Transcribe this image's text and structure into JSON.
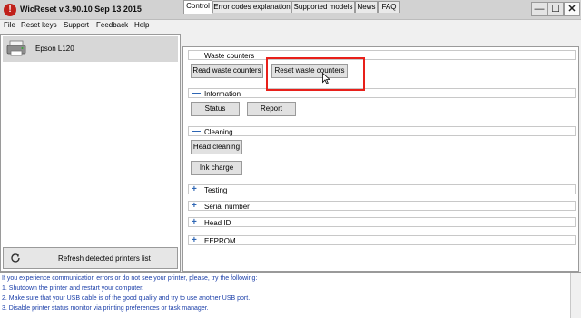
{
  "window": {
    "title": "WicReset v.3.90.10 Sep 13 2015",
    "app_icon": "!",
    "minimize": "—",
    "maximize": "☐",
    "close": "✕"
  },
  "menu": [
    "File",
    "Reset keys",
    "Support",
    "Feedback",
    "Help"
  ],
  "printers": [
    {
      "name": "Epson L120",
      "icon": "printer-icon"
    }
  ],
  "refresh_button": "Refresh detected printers list",
  "tabs": [
    "Control",
    "Error codes explanation",
    "Supported models",
    "News",
    "FAQ"
  ],
  "active_tab": "Control",
  "groups": {
    "waste": {
      "label": "Waste counters",
      "expanded": true,
      "buttons": [
        "Read waste counters",
        "Reset waste counters"
      ]
    },
    "information": {
      "label": "Information",
      "expanded": true,
      "buttons": [
        "Status",
        "Report"
      ]
    },
    "cleaning": {
      "label": "Cleaning",
      "expanded": true,
      "buttons": [
        "Head cleaning",
        "Ink charge"
      ]
    },
    "testing": {
      "label": "Testing",
      "expanded": false
    },
    "serial": {
      "label": "Serial number",
      "expanded": false
    },
    "headid": {
      "label": "Head ID",
      "expanded": false
    },
    "eeprom": {
      "label": "EEPROM",
      "expanded": false
    }
  },
  "expanded_symbol": "—",
  "collapsed_symbol": "+",
  "info_lines": [
    "If you experience communication errors or do not see your printer, please, try the following:",
    "1. Shutdown the printer and restart your computer.",
    "2. Make sure that your USB cable is of the good quality and try to use another USB port.",
    "3. Disable printer status monitor via printing preferences or task manager."
  ],
  "colors": {
    "highlight": "#e8201a",
    "info_text": "#1a3ea8",
    "group_icon": "#2e66b4",
    "title_bar": "#d2d2d2"
  }
}
